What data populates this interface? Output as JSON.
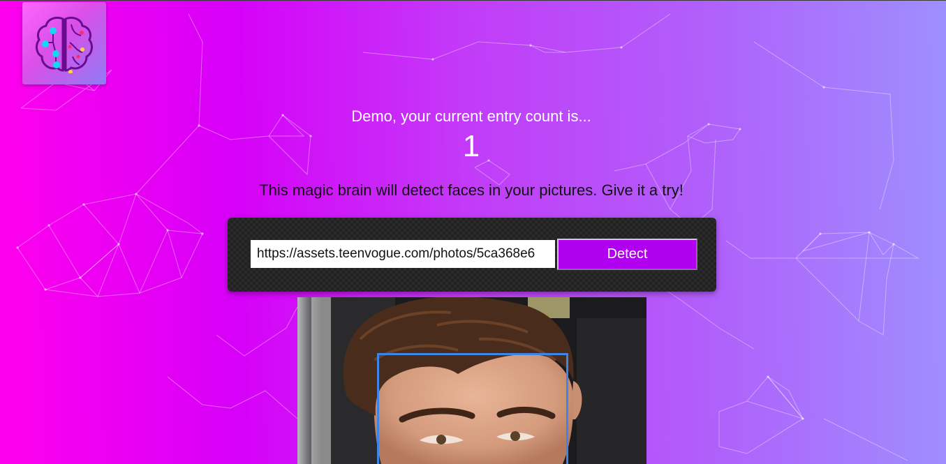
{
  "app": {
    "logo_icon": "brain-icon",
    "accent_color": "#b000ef",
    "face_box_color": "#3d86e8"
  },
  "rank": {
    "label": "Demo, your current entry count is...",
    "count": "1"
  },
  "intro": {
    "text": "This magic brain will detect faces in your pictures. Give it a try!"
  },
  "image_form": {
    "url_value": "https://assets.teenvogue.com/photos/5ca368e6",
    "url_placeholder": "",
    "button_label": "Detect"
  },
  "face_recognition": {
    "faces_detected": 1
  }
}
